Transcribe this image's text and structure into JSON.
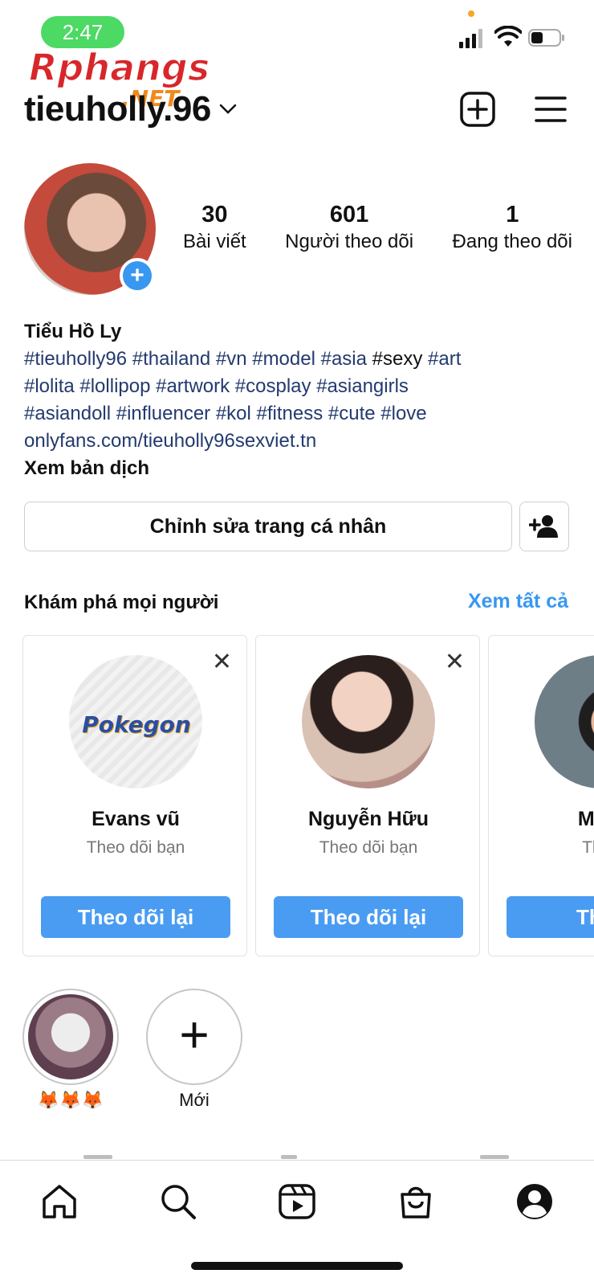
{
  "status_bar": {
    "time": "2:47"
  },
  "watermark": {
    "text": "Rphangs",
    "sub": ".NET"
  },
  "profile": {
    "username": "tieuholly.96",
    "stats": [
      {
        "value": "30",
        "label": "Bài viết"
      },
      {
        "value": "601",
        "label": "Người theo dõi"
      },
      {
        "value": "1",
        "label": "Đang theo dõi"
      }
    ],
    "display_name": "Tiểu Hồ Ly",
    "bio_line1_a": "#tieuholly96 #thailand #vn #model #asia ",
    "bio_line1_b": "#sexy",
    "bio_line1_c": " #art",
    "bio_line2": "#lolita #lollipop #artwork #cosplay #asiangirls",
    "bio_line3": "#asiandoll #influencer #kol #fitness #cute #love",
    "link": "onlyfans.com/tieuholly96sexviet.tn",
    "translate": "Xem bản dịch",
    "edit_button": "Chỉnh sửa trang cá nhân"
  },
  "discover": {
    "title": "Khám phá mọi người",
    "see_all": "Xem tất cả",
    "cards": [
      {
        "name": "Evans vũ",
        "subtitle": "Theo dõi bạn",
        "button": "Theo dõi lại",
        "badge": "Pokegon"
      },
      {
        "name": "Nguyễn Hữu",
        "subtitle": "Theo dõi bạn",
        "button": "Theo dõi lại"
      },
      {
        "name": "Minh",
        "subtitle": "Theo",
        "button": "Theo"
      }
    ]
  },
  "highlights": [
    {
      "label": "🦊🦊🦊"
    },
    {
      "label": "Mới"
    }
  ],
  "colors": {
    "accent": "#3897f0",
    "follow_button": "#4a9cf2",
    "hashtag": "#233a6e",
    "status_pill": "#4cd964"
  },
  "nav": [
    "home-icon",
    "search-icon",
    "reels-icon",
    "shop-icon",
    "profile-icon"
  ]
}
